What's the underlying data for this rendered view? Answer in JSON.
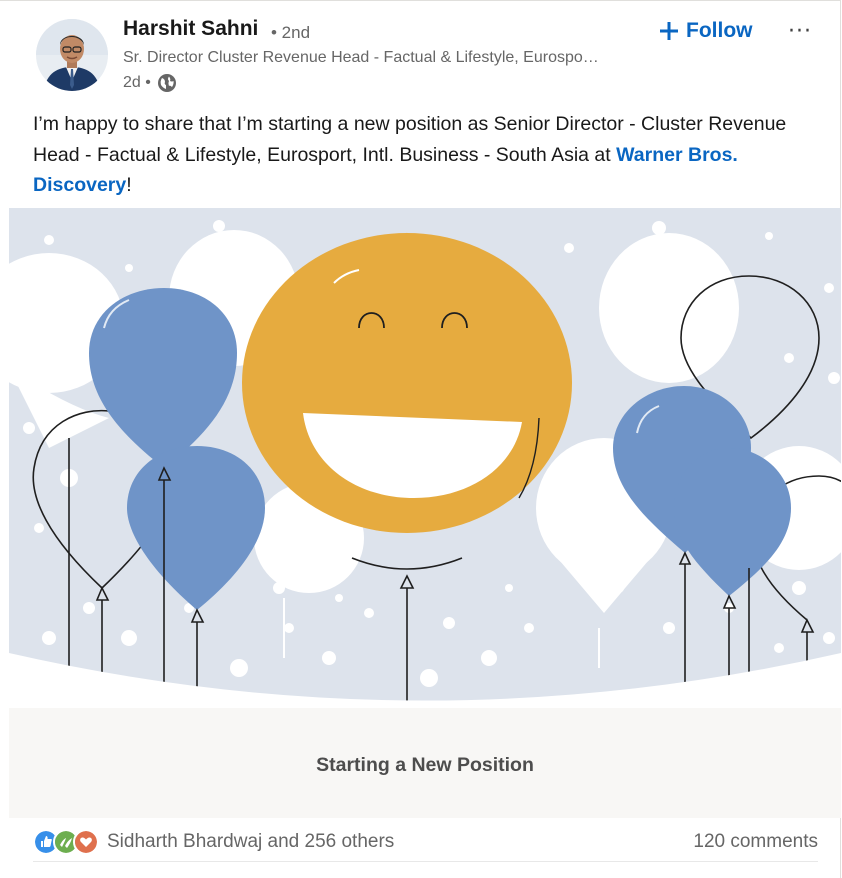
{
  "author": {
    "name": "Harshit Sahni",
    "degree": "• 2nd",
    "headline": "Sr. Director Cluster Revenue Head - Factual & Lifestyle, Eurospo…",
    "time": "2d •"
  },
  "actions": {
    "follow_label": "Follow",
    "more_label": "···"
  },
  "post": {
    "text_before": "I’m happy to share that I’m starting a new position as Senior Director - Cluster Revenue Head - Factual & Lifestyle, Eurosport, Intl. Business - South Asia at ",
    "mention": "Warner Bros. Discovery",
    "text_after": "!"
  },
  "media": {
    "caption": "Starting a New Position"
  },
  "social": {
    "reactions_text": "Sidharth Bhardwaj and 256 others",
    "comments_text": "120 comments"
  },
  "colors": {
    "accent": "#0a66c2",
    "balloon_blue": "#6f94c8",
    "sun_yellow": "#e6ab3f",
    "sky": "#dde3ec"
  },
  "icons": {
    "follow": "plus-icon",
    "more": "ellipsis-icon",
    "visibility": "globe-icon",
    "reactions": [
      "like-icon",
      "support-icon",
      "love-icon"
    ]
  }
}
